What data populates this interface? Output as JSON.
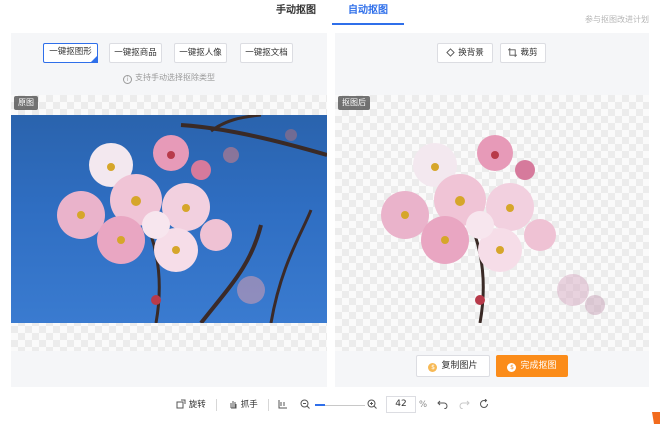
{
  "tabs": [
    {
      "label": "手动抠图"
    },
    {
      "label": "自动抠图"
    }
  ],
  "feedback_link": "参与抠图改进计划",
  "left_panel": {
    "types": [
      {
        "label": "一键抠图形"
      },
      {
        "label": "一键抠商品"
      },
      {
        "label": "一键抠人像"
      },
      {
        "label": "一键抠文档"
      }
    ],
    "hint": "支持手动选择抠除类型",
    "image_label": "原图"
  },
  "right_panel": {
    "tools": [
      {
        "label": "换背景"
      },
      {
        "label": "裁剪"
      }
    ],
    "image_label": "抠图后",
    "copy_button": "复制图片",
    "finish_button": "完成抠图"
  },
  "bottom_bar": {
    "rotate": "旋转",
    "grab": "抓手",
    "zoom_value": "42",
    "zoom_unit": "%"
  },
  "colors": {
    "accent": "#2f6fea",
    "finish": "#fb8c1a"
  }
}
